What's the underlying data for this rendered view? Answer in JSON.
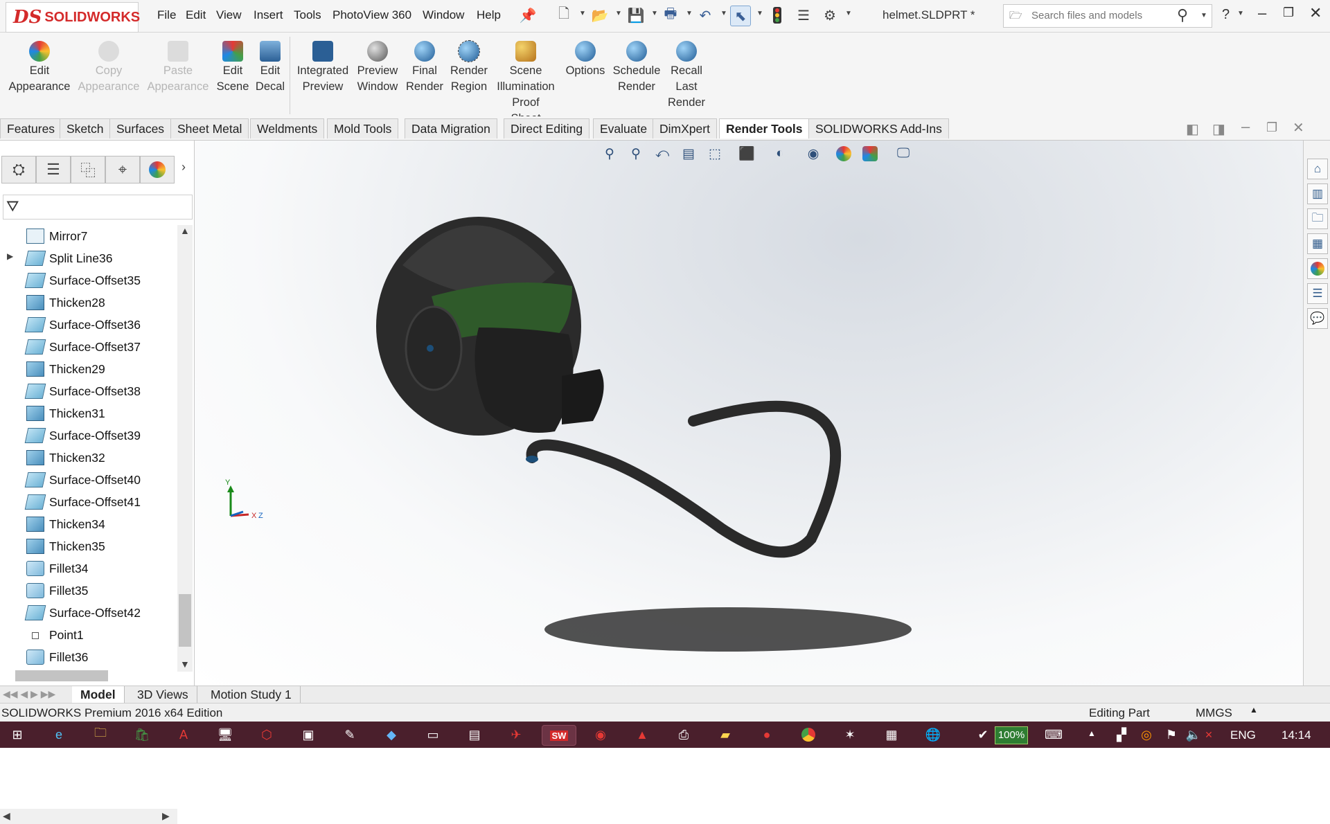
{
  "app": {
    "title": "SOLIDWORKS",
    "filename": "helmet.SLDPRT *"
  },
  "menu": [
    "File",
    "Edit",
    "View",
    "Insert",
    "Tools",
    "PhotoView 360",
    "Window",
    "Help"
  ],
  "search": {
    "placeholder": "Search files and models"
  },
  "ribbon": {
    "buttons": [
      {
        "label": "Edit Appearance",
        "icon": "edit-appearance-icon",
        "enabled": true
      },
      {
        "label": "Copy Appearance",
        "icon": "copy-appearance-icon",
        "enabled": false
      },
      {
        "label": "Paste Appearance",
        "icon": "paste-appearance-icon",
        "enabled": false
      },
      {
        "label": "Edit Scene",
        "icon": "edit-scene-icon",
        "enabled": true
      },
      {
        "label": "Edit Decal",
        "icon": "edit-decal-icon",
        "enabled": true
      },
      {
        "label": "Integrated Preview",
        "icon": "integrated-preview-icon",
        "enabled": true
      },
      {
        "label": "Preview Window",
        "icon": "preview-window-icon",
        "enabled": true
      },
      {
        "label": "Final Render",
        "icon": "final-render-icon",
        "enabled": true
      },
      {
        "label": "Render Region",
        "icon": "render-region-icon",
        "enabled": true
      },
      {
        "label": "Scene Illumination Proof Sheet",
        "icon": "scene-illumination-icon",
        "enabled": true
      },
      {
        "label": "Options",
        "icon": "options-icon",
        "enabled": true
      },
      {
        "label": "Schedule Render",
        "icon": "schedule-render-icon",
        "enabled": true
      },
      {
        "label": "Recall Last Render",
        "icon": "recall-render-icon",
        "enabled": true
      }
    ]
  },
  "command_tabs": [
    "Features",
    "Sketch",
    "Surfaces",
    "Sheet Metal",
    "Weldments",
    "Mold Tools",
    "Data Migration",
    "Direct Editing",
    "Evaluate",
    "DimXpert",
    "Render Tools",
    "SOLIDWORKS Add-Ins"
  ],
  "active_tab": "Render Tools",
  "feature_tree": [
    {
      "label": "Mirror7",
      "type": "mirror",
      "expandable": false
    },
    {
      "label": "Split Line36",
      "type": "surf",
      "expandable": true
    },
    {
      "label": "Surface-Offset35",
      "type": "surf",
      "expandable": false
    },
    {
      "label": "Thicken28",
      "type": "thick",
      "expandable": false
    },
    {
      "label": "Surface-Offset36",
      "type": "surf",
      "expandable": false
    },
    {
      "label": "Surface-Offset37",
      "type": "surf",
      "expandable": false
    },
    {
      "label": "Thicken29",
      "type": "thick",
      "expandable": false
    },
    {
      "label": "Surface-Offset38",
      "type": "surf",
      "expandable": false
    },
    {
      "label": "Thicken31",
      "type": "thick",
      "expandable": false
    },
    {
      "label": "Surface-Offset39",
      "type": "surf",
      "expandable": false
    },
    {
      "label": "Thicken32",
      "type": "thick",
      "expandable": false
    },
    {
      "label": "Surface-Offset40",
      "type": "surf",
      "expandable": false
    },
    {
      "label": "Surface-Offset41",
      "type": "surf",
      "expandable": false
    },
    {
      "label": "Thicken34",
      "type": "thick",
      "expandable": false
    },
    {
      "label": "Thicken35",
      "type": "thick",
      "expandable": false
    },
    {
      "label": "Fillet34",
      "type": "fillet",
      "expandable": false
    },
    {
      "label": "Fillet35",
      "type": "fillet",
      "expandable": false
    },
    {
      "label": "Surface-Offset42",
      "type": "surf",
      "expandable": false
    },
    {
      "label": "Point1",
      "type": "point",
      "expandable": false
    },
    {
      "label": "Fillet36",
      "type": "fillet",
      "expandable": false
    }
  ],
  "triad": {
    "x": "X",
    "y": "Y",
    "z": "Z"
  },
  "bottom_tabs": [
    "Model",
    "3D Views",
    "Motion Study 1"
  ],
  "active_bottom_tab": "Model",
  "status": {
    "edition": "SOLIDWORKS Premium 2016 x64 Edition",
    "mode": "Editing Part",
    "units": "MMGS"
  },
  "taskbar": {
    "battery": "100%",
    "language": "ENG",
    "time": "14:14"
  },
  "colors": {
    "brand": "#d42a2a",
    "taskbar": "#4a1f2c",
    "helmet": "#2a2a2a",
    "visor": "#2f5a2a"
  }
}
